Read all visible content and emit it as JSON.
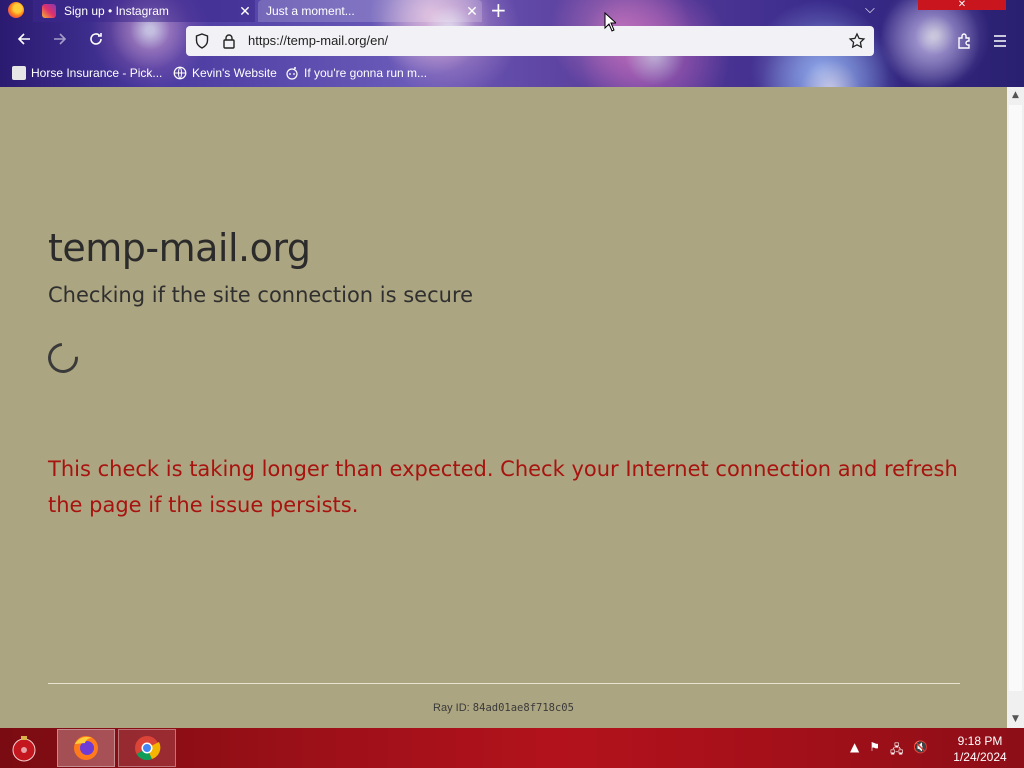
{
  "browser": {
    "tabs": [
      {
        "title": "Sign up • Instagram",
        "active": false
      },
      {
        "title": "Just a moment...",
        "active": true
      }
    ],
    "url": "https://temp-mail.org/en/",
    "bookmarks": [
      {
        "label": "Horse Insurance - Pick..."
      },
      {
        "label": "Kevin's Website"
      },
      {
        "label": "If you're gonna run m..."
      }
    ]
  },
  "page": {
    "site_title": "temp-mail.org",
    "subtitle": "Checking if the site connection is secure",
    "error_message": "This check is taking longer than expected. Check your Internet connection and refresh the page if the issue persists.",
    "ray_label": "Ray ID:",
    "ray_id": "84ad01ae8f718c05"
  },
  "taskbar": {
    "apps": [
      "firefox",
      "chrome"
    ],
    "time": "9:18 PM",
    "date": "1/24/2024"
  },
  "colors": {
    "page_bg": "#aca581",
    "error_text": "#a7140f",
    "taskbar_red": "#b3121c"
  }
}
